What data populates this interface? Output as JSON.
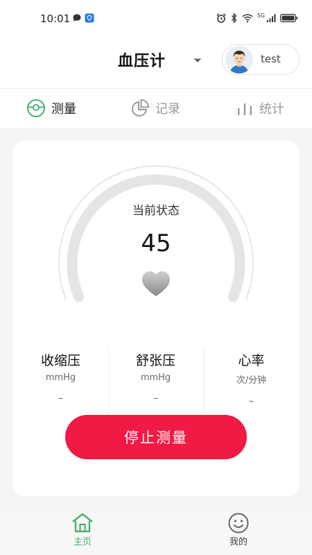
{
  "status_bar": {
    "time": "10:01",
    "network": "5G"
  },
  "header": {
    "title": "血压计",
    "user": {
      "name": "test"
    }
  },
  "tabs": [
    {
      "label": "测量",
      "icon": "gauge-icon",
      "active": true
    },
    {
      "label": "记录",
      "icon": "pie-chart-icon",
      "active": false
    },
    {
      "label": "统计",
      "icon": "bar-chart-icon",
      "active": false
    }
  ],
  "gauge": {
    "label": "当前状态",
    "value": "45"
  },
  "metrics": [
    {
      "name": "收缩压",
      "unit": "mmHg",
      "value": "–"
    },
    {
      "name": "舒张压",
      "unit": "mmHg",
      "value": "–"
    },
    {
      "name": "心率",
      "unit": "次/分钟",
      "value": "–"
    }
  ],
  "stop_button": {
    "label": "停止测量"
  },
  "bottom_nav": [
    {
      "label": "主页",
      "icon": "home-icon",
      "active": true
    },
    {
      "label": "我的",
      "icon": "smiley-icon",
      "active": false
    }
  ],
  "colors": {
    "accent_green": "#4caf72",
    "stop_red": "#f01a45",
    "inactive_gray": "#9a9a9a"
  }
}
